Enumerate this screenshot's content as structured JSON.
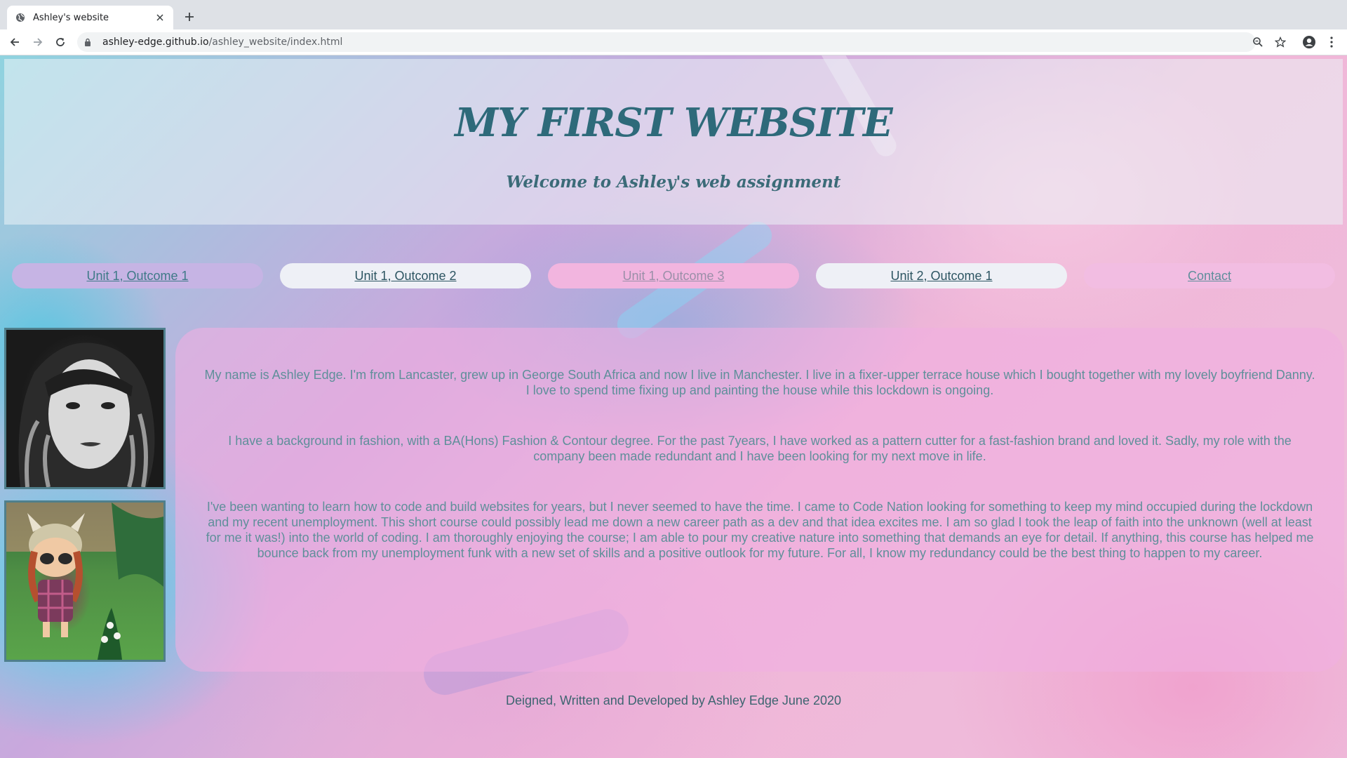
{
  "browser": {
    "tab_title": "Ashley's website",
    "url_host": "ashley-edge.github.io",
    "url_path": "/ashley_website/index.html"
  },
  "header": {
    "title": "MY FIRST WEBSITE",
    "subtitle": "Welcome to Ashley's web assignment"
  },
  "nav": {
    "items": [
      {
        "label": "Unit 1, Outcome 1",
        "bg": "#c6b4e4",
        "color": "#3f7a88"
      },
      {
        "label": "Unit 1, Outcome 2",
        "bg": "#eef0f6",
        "color": "#2d5562"
      },
      {
        "label": "Unit 1, Outcome 3",
        "bg": "#f2b5df",
        "color": "#9a8fa8"
      },
      {
        "label": "Unit 2, Outcome 1",
        "bg": "#eef0f6",
        "color": "#2d5562"
      },
      {
        "label": "Contact",
        "bg": "#f2bde2",
        "color": "#5f8e9b"
      }
    ]
  },
  "content": {
    "paragraphs": [
      "My name is Ashley Edge. I'm from Lancaster, grew up in George South Africa and now I live in Manchester. I live in a fixer-upper terrace house which I bought together with my lovely boyfriend Danny. I love to spend time fixing up and painting the house while this lockdown is ongoing.",
      "I have a background in fashion, with a BA(Hons) Fashion & Contour degree. For the past 7years, I have worked as a pattern cutter for a fast-fashion brand and loved it. Sadly, my role with the company been made redundant and I have been looking for my next move in life.",
      "I've been wanting to learn how to code and build websites for years, but I never seemed to have the time. I came to Code Nation looking for something to keep my mind occupied during the lockdown and my recent unemployment. This short course could possibly lead me down a new career path as a dev and that idea excites me. I am so glad I took the leap of faith into the unknown (well at least for me it was!) into the world of coding. I am thoroughly enjoying the course; I am able to pour my creative nature into something that demands an eye for detail. If anything, this course has helped me bounce back from my unemployment funk with a new set of skills and a positive outlook for my future. For all, I know my redundancy could be the best thing to happen to my career."
    ]
  },
  "footer": {
    "text": "Deigned, Written and Developed by Ashley Edge June 2020"
  }
}
